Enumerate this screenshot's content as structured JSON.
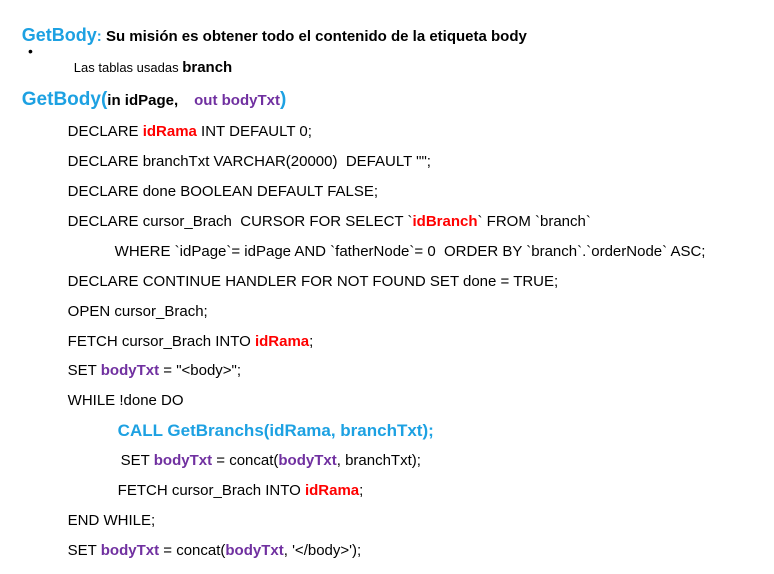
{
  "heading": {
    "title": "GetBody",
    "colon": ":",
    "description": " Su misión es obtener todo el contenido de la etiqueta body"
  },
  "bullet": {
    "symbol": "•",
    "prefix": "Las tablas usadas ",
    "table": "branch"
  },
  "signature": {
    "name": "GetBody(",
    "param1": "in idPage,",
    "out_keyword": "out ",
    "param2": "bodyTxt",
    "close": ")"
  },
  "code": {
    "l1": [
      "DECLARE ",
      "idRama",
      " INT DEFAULT 0;"
    ],
    "l2": [
      "DECLARE branchTxt VARCHAR(20000)  DEFAULT \"\";"
    ],
    "l3": [
      "DECLARE done BOOLEAN DEFAULT FALSE;"
    ],
    "l4": [
      "DECLARE cursor_Brach  CURSOR FOR SELECT `",
      "idBranch",
      "` FROM `branch`"
    ],
    "l5": [
      "WHERE `idPage`= idPage AND `fatherNode`= 0  ORDER BY `branch`.`orderNode` ASC;"
    ],
    "l6": [
      "DECLARE CONTINUE HANDLER FOR NOT FOUND SET done = TRUE;"
    ],
    "l7": [
      "OPEN cursor_Brach;"
    ],
    "l8": [
      "FETCH cursor_Brach INTO ",
      "idRama",
      ";"
    ],
    "l9": [
      "SET ",
      "bodyTxt",
      " = \"<body>\";"
    ],
    "l10": [
      "WHILE !done DO"
    ],
    "l11": [
      "CALL GetBranchs(idRama, branchTxt);"
    ],
    "l12": [
      "SET ",
      "bodyTxt",
      " = concat(",
      "bodyTxt",
      ", branchTxt);"
    ],
    "l13": [
      "FETCH cursor_Brach INTO ",
      "idRama",
      ";"
    ],
    "l14": [
      "END WHILE;"
    ],
    "l15": [
      "SET ",
      "bodyTxt",
      " = concat(",
      "bodyTxt",
      ", '</body>');"
    ]
  },
  "colors": {
    "title_blue": "#1da1e2",
    "keyword_red": "#ff0000",
    "variable_purple": "#7030a0"
  }
}
